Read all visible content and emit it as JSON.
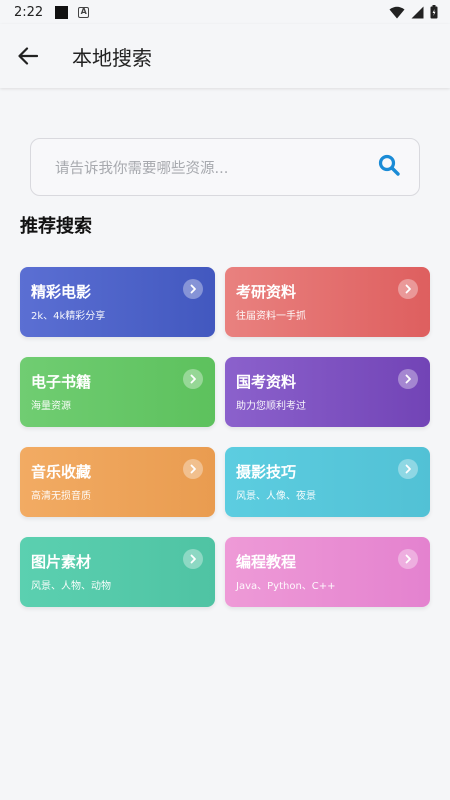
{
  "status_bar": {
    "time": "2:22",
    "icons": [
      "notification-square-icon",
      "a-icon",
      "wifi-icon",
      "cellular-icon",
      "battery-icon"
    ]
  },
  "appbar": {
    "back_icon": "arrow-left-icon",
    "title": "本地搜索"
  },
  "search": {
    "placeholder": "请告诉我你需要哪些资源...",
    "icon": "search-icon",
    "icon_color": "#1a8bd6"
  },
  "section_title": "推荐搜索",
  "cards": [
    {
      "title": "精彩电影",
      "subtitle": "2k、4k精彩分享",
      "color": "#4f63c9"
    },
    {
      "title": "考研资料",
      "subtitle": "往届资料一手抓",
      "color": "#e26a69"
    },
    {
      "title": "电子书籍",
      "subtitle": "海量资源",
      "color": "#66c767"
    },
    {
      "title": "国考资料",
      "subtitle": "助力您顺利考过",
      "color": "#7d51c0"
    },
    {
      "title": "音乐收藏",
      "subtitle": "高清无损音质",
      "color": "#eda559"
    },
    {
      "title": "摄影技巧",
      "subtitle": "风景、人像、夜景",
      "color": "#57c7db"
    },
    {
      "title": "图片素材",
      "subtitle": "风景、人物、动物",
      "color": "#55caa9"
    },
    {
      "title": "编程教程",
      "subtitle": "Java、Python、C++",
      "color": "#e98ed3"
    }
  ]
}
